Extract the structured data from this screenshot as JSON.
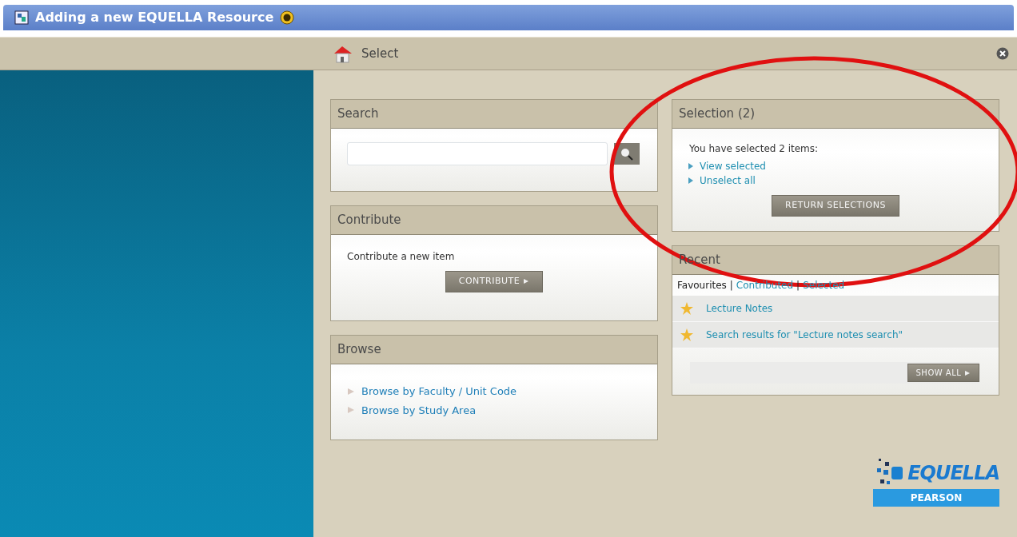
{
  "window": {
    "title": "Adding a new EQUELLA Resource"
  },
  "toolbar": {
    "title": "Select"
  },
  "search": {
    "heading": "Search"
  },
  "contribute": {
    "heading": "Contribute",
    "text": "Contribute a new item",
    "button": "CONTRIBUTE"
  },
  "browse": {
    "heading": "Browse",
    "links": [
      "Browse by Faculty / Unit Code",
      "Browse by Study Area"
    ]
  },
  "selection": {
    "heading": "Selection (2)",
    "text": "You have selected 2 items:",
    "links": [
      "View selected",
      "Unselect all"
    ],
    "button": "RETURN SELECTIONS"
  },
  "recent": {
    "heading": "Recent",
    "tabs": [
      {
        "label": "Favourites",
        "selected": true
      },
      {
        "label": "Contributed",
        "selected": false
      },
      {
        "label": "Selected",
        "selected": false
      }
    ],
    "separators": [
      "|",
      "|"
    ],
    "items": [
      "Lecture Notes",
      "Search results for \"Lecture notes search\""
    ],
    "button": "SHOW ALL"
  },
  "logo": {
    "name": "EQUELLA",
    "sub": "PEARSON"
  }
}
